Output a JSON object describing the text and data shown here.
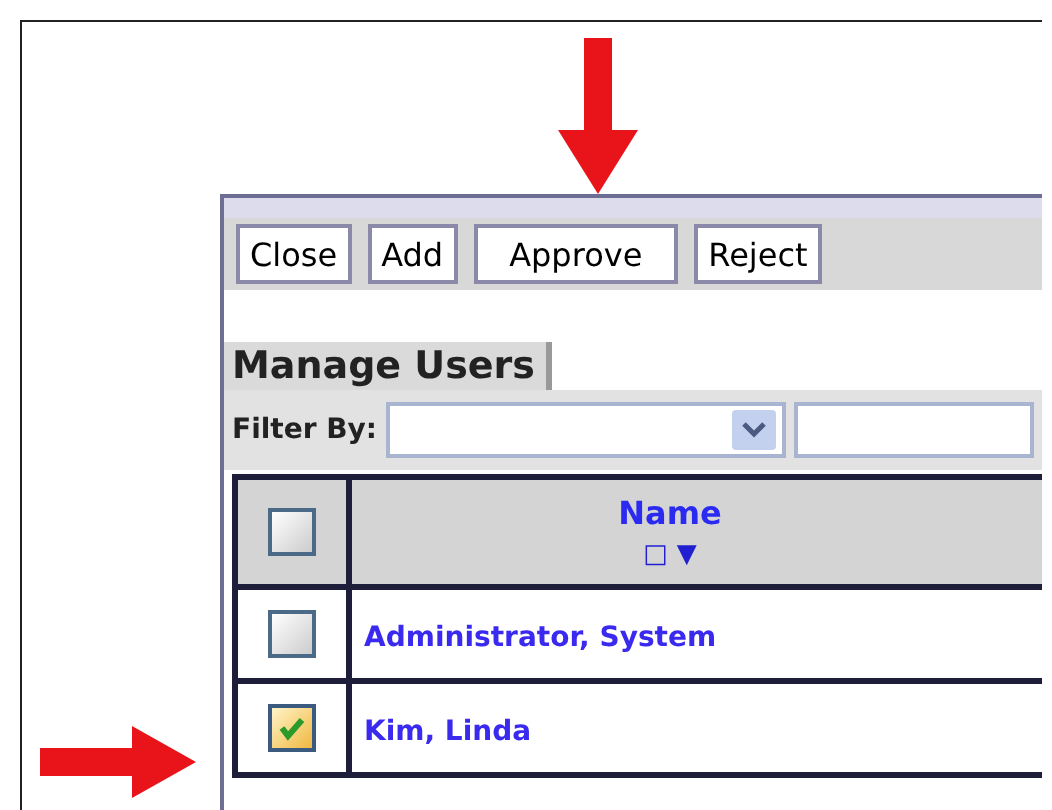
{
  "toolbar": {
    "buttons": [
      "Close",
      "Add",
      "Approve",
      "Reject"
    ]
  },
  "heading": "Manage Users",
  "filter": {
    "label": "Filter By:"
  },
  "table": {
    "header_checkbox": {
      "checked": false
    },
    "columns": [
      {
        "label": "Name",
        "sort_indicator": "□ ▼"
      }
    ],
    "rows": [
      {
        "checked": false,
        "name": "Administrator, System"
      },
      {
        "checked": true,
        "name": "Kim, Linda"
      }
    ]
  }
}
